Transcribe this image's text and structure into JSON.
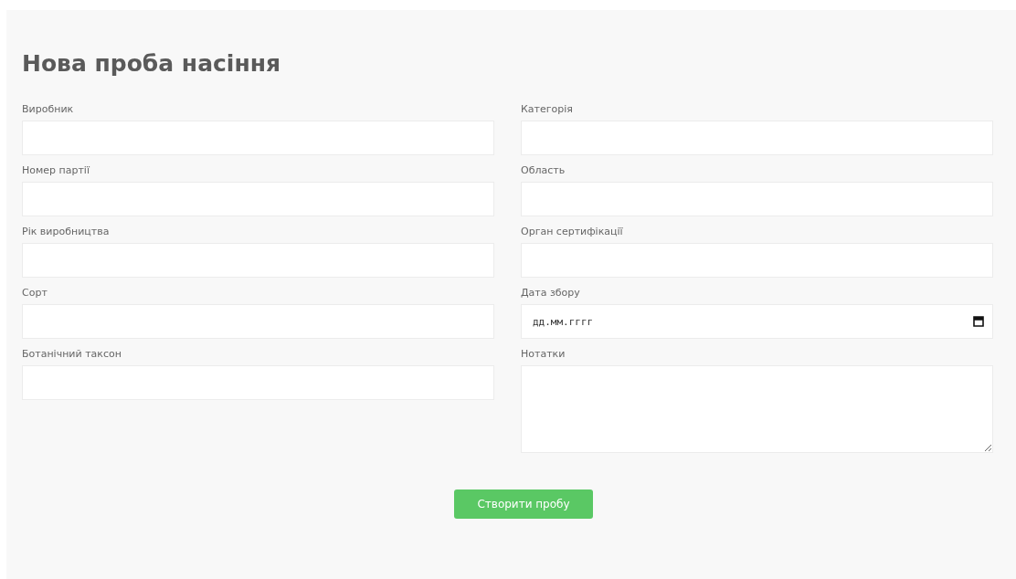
{
  "title": "Нова проба насіння",
  "columns": [
    [
      {
        "label": "Виробник",
        "kind": "text"
      },
      {
        "label": "Номер партії",
        "kind": "text"
      },
      {
        "label": "Рік виробництва",
        "kind": "text"
      },
      {
        "label": "Сорт",
        "kind": "text"
      },
      {
        "label": "Ботанічний таксон",
        "kind": "text"
      }
    ],
    [
      {
        "label": "Категорія",
        "kind": "text"
      },
      {
        "label": "Область",
        "kind": "text"
      },
      {
        "label": "Орган сертифікації",
        "kind": "text"
      },
      {
        "label": "Дата збору",
        "kind": "date",
        "placeholder": "дд.мм.гггг"
      },
      {
        "label": "Нотатки",
        "kind": "textarea"
      }
    ]
  ],
  "submit_button": "Створити пробу"
}
